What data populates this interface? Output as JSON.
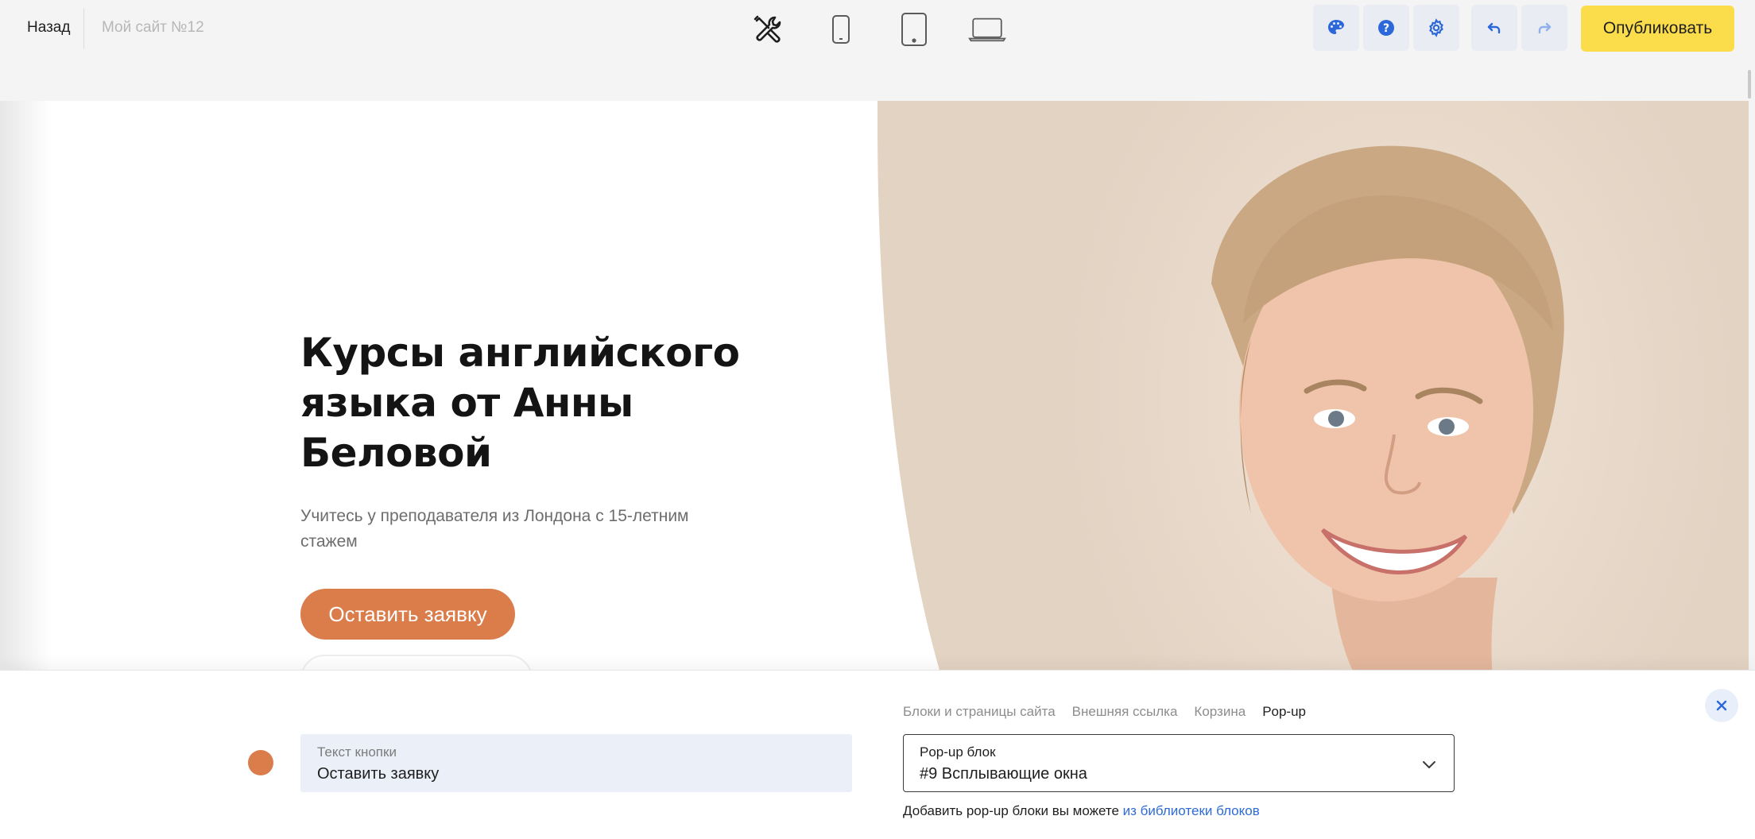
{
  "topbar": {
    "back_label": "Назад",
    "site_name": "Мой сайт №12",
    "devices": [
      "tools-icon",
      "phone-icon",
      "tablet-icon",
      "laptop-icon"
    ],
    "actions": [
      "palette-icon",
      "help-icon",
      "settings-icon",
      "undo-icon",
      "redo-icon"
    ],
    "publish_label": "Опубликовать"
  },
  "hero": {
    "title": "Курсы английского языка от Анны Беловой",
    "subtitle": "Учитесь у преподавателя из Лондона с 15-летним стажем",
    "cta_label": "Оставить заявку"
  },
  "editor": {
    "button_text_label": "Текст кнопки",
    "button_text_value": "Оставить заявку",
    "link_types": [
      "Блоки и страницы сайта",
      "Внешняя ссылка",
      "Корзина",
      "Pop-up"
    ],
    "active_link_type": "Pop-up",
    "popup_label": "Pop-up блок",
    "popup_value": "#9 Всплывающие окна",
    "hint_text": "Добавить pop-up блоки вы можете ",
    "hint_link": "из библиотеки блоков"
  },
  "colors": {
    "accent": "#db7d4b",
    "publish": "#fbdd4c",
    "link": "#2e6bd8",
    "action_icon": "#2c68d9"
  }
}
